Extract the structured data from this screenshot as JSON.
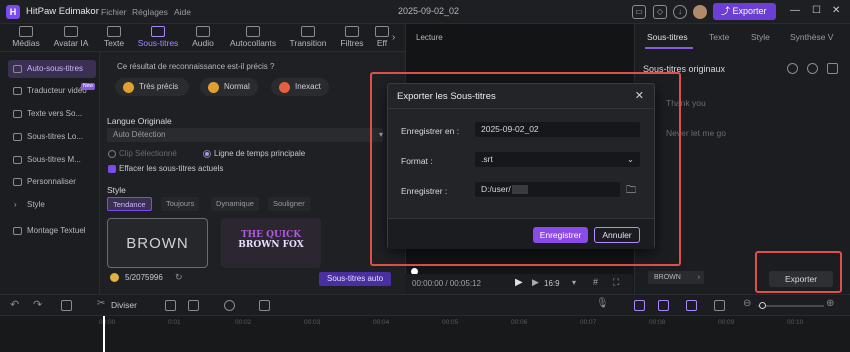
{
  "titlebar": {
    "app_name": "HitPaw Edimakor",
    "menu": [
      "Fichier",
      "Réglages",
      "Aide"
    ],
    "project_date": "2025-09-02_02",
    "export_label": "Exporter",
    "accent": "#6b3fd4"
  },
  "tool_tabs": [
    {
      "label": "Médias",
      "icon": "folder-icon"
    },
    {
      "label": "Avatar IA",
      "icon": "avatar-icon"
    },
    {
      "label": "Texte",
      "icon": "text-icon"
    },
    {
      "label": "Sous-titres",
      "icon": "subtitles-icon"
    },
    {
      "label": "Audio",
      "icon": "music-icon"
    },
    {
      "label": "Autocollants",
      "icon": "sticker-icon"
    },
    {
      "label": "Transition",
      "icon": "transition-icon"
    },
    {
      "label": "Filtres",
      "icon": "filter-icon"
    },
    {
      "label": "Eff",
      "icon": "effects-icon"
    }
  ],
  "sidebar": {
    "items": [
      {
        "label": "Auto-sous-titres"
      },
      {
        "label": "Traducteur vidéo",
        "badge": "New"
      },
      {
        "label": "Texte vers So..."
      },
      {
        "label": "Sous-titres Lo..."
      },
      {
        "label": "Sous-titres M..."
      },
      {
        "label": "Personnaliser"
      },
      {
        "label": "Style"
      },
      {
        "label": "Montage Textuel"
      }
    ]
  },
  "panel": {
    "question": "Ce résultat de reconnaissance est-il précis ?",
    "ratings": [
      "Très précis",
      "Normal",
      "Inexact"
    ],
    "language_heading": "Langue Originale",
    "language_value": "Auto Détection",
    "radio_clip": "Clip Sélectionné",
    "radio_timeline": "Ligne de temps principale",
    "erase_label": "Effacer les sous-titres actuels",
    "style_heading": "Style",
    "style_tabs": [
      "Tendance",
      "Toujours",
      "Dynamique",
      "Souligner"
    ],
    "preview1": "BROWN",
    "preview2_line1": "THE QUICK",
    "preview2_line2": "BROWN FOX",
    "credits": "5/2075996",
    "autosub_button": "Sous-titres auto"
  },
  "player": {
    "title": "Lecture",
    "time": "00:00:00 / 00:05:12",
    "ratio": "16:9"
  },
  "right_panel": {
    "tabs": [
      "Sous-titres",
      "Texte",
      "Style",
      "Synthèse V"
    ],
    "heading": "Sous-titres originaux",
    "lines": [
      "Thank you",
      "Never let me go"
    ],
    "style_chip": "BROWN",
    "export_button": "Exporter"
  },
  "timeline": {
    "split_label": "Diviser",
    "ticks": [
      "00:00",
      "0:01",
      "00:02",
      "00:03",
      "00:04",
      "00:05",
      "00:06",
      "00:07",
      "00:08",
      "00:09",
      "00:10"
    ]
  },
  "dialog": {
    "title": "Exporter les Sous-titres",
    "save_as_label": "Enregistrer en :",
    "save_as_value": "2025-09-02_02",
    "format_label": "Format :",
    "format_value": ".srt",
    "save_path_label": "Enregistrer :",
    "save_path_value": "D:/user/",
    "primary_button": "Enregistrer",
    "cancel_button": "Annuler",
    "primary_color": "#8a4be8"
  }
}
